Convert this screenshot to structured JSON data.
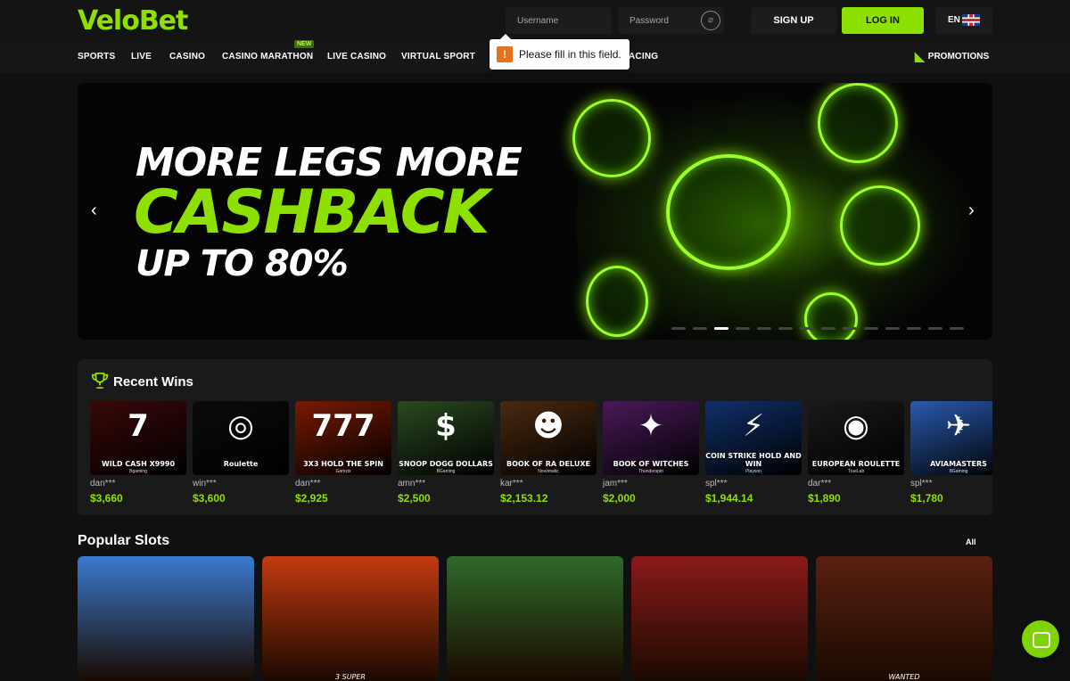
{
  "header": {
    "logo": "VeloBet",
    "username_placeholder": "Username",
    "password_placeholder": "Password",
    "signup_label": "SIGN UP",
    "login_label": "LOG IN",
    "lang_label": "EN"
  },
  "nav": {
    "items": [
      {
        "label": "SPORTS"
      },
      {
        "label": "LIVE"
      },
      {
        "label": "CASINO"
      },
      {
        "label": "CASINO MARATHON",
        "badge": "NEW"
      },
      {
        "label": "LIVE CASINO"
      },
      {
        "label": "VIRTUAL SPORT"
      },
      {
        "label": "ACING"
      }
    ],
    "promotions_label": "PROMOTIONS"
  },
  "tooltip": {
    "text": "Please fill in this field.",
    "icon": "!"
  },
  "banner": {
    "line1": "MORE LEGS MORE",
    "line2": "CASHBACK",
    "line3": "UP TO 80%",
    "prev_arrow": "‹",
    "next_arrow": "›",
    "slide_count": 14,
    "active_slide": 3
  },
  "recent_wins": {
    "title": "Recent Wins",
    "items": [
      {
        "game": "WILD CASH X9990",
        "provider": "Bgaming",
        "art": "7",
        "user": "dan***",
        "amount": "$3,660",
        "color": "#3a0808"
      },
      {
        "game": "Roulette",
        "provider": "",
        "art": "◎",
        "user": "win***",
        "amount": "$3,600",
        "color": "#0b0b0b"
      },
      {
        "game": "3X3 HOLD THE SPIN",
        "provider": "Gamzix",
        "art": "777",
        "user": "dan***",
        "amount": "$2,925",
        "color": "#7a1a00"
      },
      {
        "game": "SNOOP DOGG DOLLARS",
        "provider": "BGaming",
        "art": "$",
        "user": "amn***",
        "amount": "$2,500",
        "color": "#2a4a20"
      },
      {
        "game": "BOOK OF RA DELUXE",
        "provider": "Novomatic",
        "art": "☻",
        "user": "kar***",
        "amount": "$2,153.12",
        "color": "#4a2a10"
      },
      {
        "game": "BOOK OF WITCHES",
        "provider": "Thunderspin",
        "art": "✦",
        "user": "jam***",
        "amount": "$2,000",
        "color": "#4a1a5a"
      },
      {
        "game": "COIN STRIKE HOLD AND WIN",
        "provider": "Playson",
        "art": "⚡",
        "user": "spl***",
        "amount": "$1,944.14",
        "color": "#10306a"
      },
      {
        "game": "EUROPEAN ROULETTE",
        "provider": "TrueLab",
        "art": "◉",
        "user": "dar***",
        "amount": "$1,890",
        "color": "#1a1a1a"
      },
      {
        "game": "AVIAMASTERS",
        "provider": "BGaming",
        "art": "✈",
        "user": "spl***",
        "amount": "$1,780",
        "color": "#2a5ab0"
      }
    ]
  },
  "popular_slots": {
    "title": "Popular Slots",
    "all_label": "All",
    "items": [
      {
        "label": "",
        "color": "#3a7ad0"
      },
      {
        "label": "3 SUPER",
        "color": "#c23a10"
      },
      {
        "label": "",
        "color": "#2f6a2a"
      },
      {
        "label": "",
        "color": "#8a1a1a"
      },
      {
        "label": "WANTED",
        "color": "#5a2010"
      }
    ]
  },
  "colors": {
    "accent": "#8ee000",
    "bg": "#101010",
    "panel": "#1a1a1a"
  }
}
